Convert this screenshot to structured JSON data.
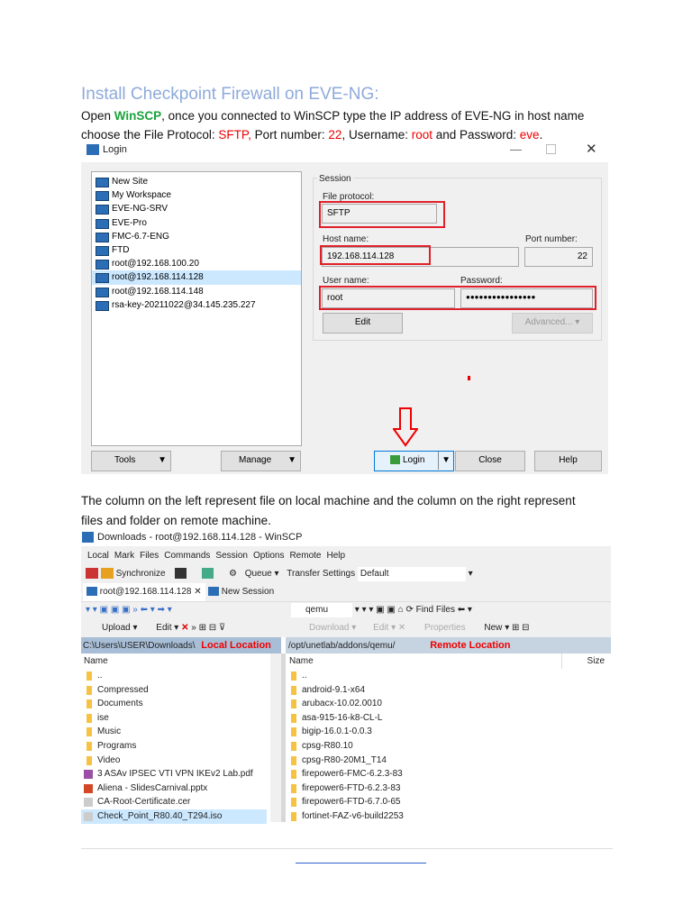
{
  "heading": "Install Checkpoint Firewall on EVE-NG:",
  "intro": {
    "p1": "Open ",
    "winscp": "WinSCP",
    "p2": ", once you connected to WinSCP type the IP address of EVE-NG in host name",
    "p3": "choose the File Protocol: ",
    "sftp": "SFTP,",
    "p4": " Port number: ",
    "port": "22",
    "p5": ", Username: ",
    "user": "root",
    "p6": " and Password: ",
    "pass": "eve",
    "p7": "."
  },
  "login": {
    "title": "Login",
    "sites": [
      "New Site",
      "My Workspace",
      "EVE-NG-SRV",
      "EVE-Pro",
      "FMC-6.7-ENG",
      "FTD",
      "root@192.168.100.20",
      "root@192.168.114.128",
      "root@192.168.114.148",
      "rsa-key-20211022@34.145.235.227"
    ],
    "session_label": "Session",
    "file_protocol_label": "File protocol:",
    "file_protocol": "SFTP",
    "host_label": "Host name:",
    "host": "192.168.114.128",
    "port_label": "Port number:",
    "port": "22",
    "user_label": "User name:",
    "user": "root",
    "password_label": "Password:",
    "password": "●●●●●●●●●●●●●●●●",
    "edit": "Edit",
    "advanced": "Advanced...",
    "tools": "Tools",
    "manage": "Manage",
    "login": "Login",
    "close": "Close",
    "help": "Help"
  },
  "para2": {
    "l1": "The column on the left represent file on local machine and the column on the right represent",
    "l2": "files and folder on remote machine."
  },
  "winscp": {
    "title": "Downloads - root@192.168.114.128 - WinSCP",
    "menu": [
      "Local",
      "Mark",
      "Files",
      "Commands",
      "Session",
      "Options",
      "Remote",
      "Help"
    ],
    "toolbar": {
      "synchronize": "Synchronize",
      "queue": "Queue",
      "transfer_settings": "Transfer Settings",
      "transfer_value": "Default"
    },
    "tabs": [
      "root@192.168.114.128",
      "New Session"
    ],
    "remote_dir": "qemu",
    "find_files": "Find Files",
    "local_actions": {
      "upload": "Upload",
      "edit": "Edit"
    },
    "remote_actions": {
      "download": "Download",
      "edit": "Edit",
      "properties": "Properties",
      "new": "New"
    },
    "local_path": "C:\\Users\\USER\\Downloads\\",
    "local_annot": "Local Location",
    "remote_path": "/opt/unetlab/addons/qemu/",
    "remote_annot": "Remote Location",
    "col_name": "Name",
    "col_size": "Size",
    "local_files": [
      "..",
      "Compressed",
      "Documents",
      "ise",
      "Music",
      "Programs",
      "Video",
      "3 ASAv IPSEC VTI VPN IKEv2 Lab.pdf",
      "Aliena - SlidesCarnival.pptx",
      "CA-Root-Certificate.cer",
      "Check_Point_R80.40_T294.iso"
    ],
    "remote_files": [
      "..",
      "android-9.1-x64",
      "arubacx-10.02.0010",
      "asa-915-16-k8-CL-L",
      "bigip-16.0.1-0.0.3",
      "cpsg-R80.10",
      "cpsg-R80-20M1_T14",
      "firepower6-FMC-6.2.3-83",
      "firepower6-FTD-6.2.3-83",
      "firepower6-FTD-6.7.0-65",
      "fortinet-FAZ-v6-build2253"
    ]
  }
}
